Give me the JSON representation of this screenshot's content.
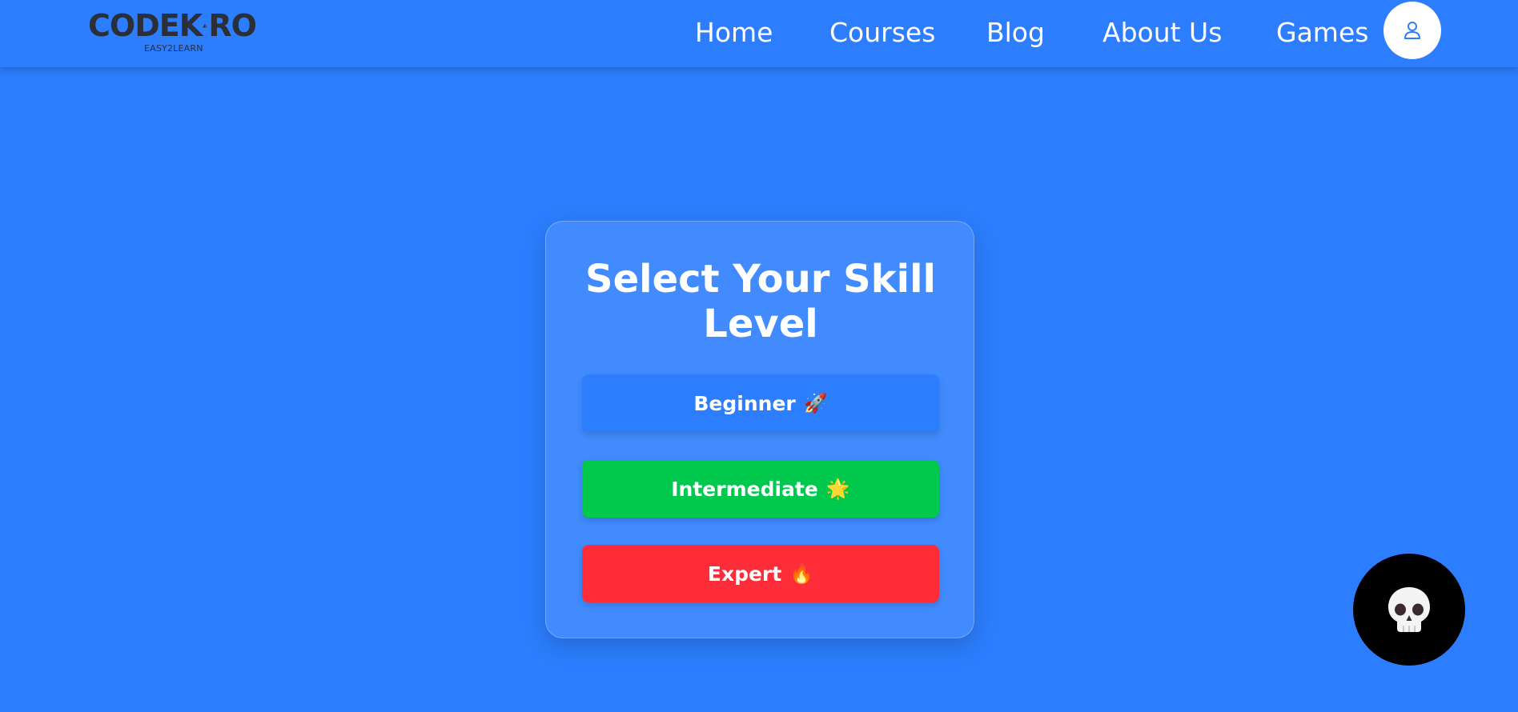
{
  "brand": {
    "logo_text_left": "CODEK",
    "logo_text_right": "RO",
    "tagline": "EASY2LEARN"
  },
  "nav": {
    "items": [
      {
        "label": "Home"
      },
      {
        "label": "Courses"
      },
      {
        "label": "Blog"
      },
      {
        "label": "About Us"
      },
      {
        "label": "Games"
      }
    ],
    "profile_icon": "user-icon"
  },
  "main": {
    "title_line1": "Select Your Skill",
    "title_line2": "Level",
    "levels": [
      {
        "label": "Beginner",
        "emoji": "🚀",
        "icon": "rocket-icon",
        "color": "#2c7efe"
      },
      {
        "label": "Intermediate",
        "emoji": "🌟",
        "icon": "star-icon",
        "color": "#00c94e"
      },
      {
        "label": "Expert",
        "emoji": "🔥",
        "icon": "fire-icon",
        "color": "#fe2b38"
      }
    ]
  },
  "floating_button": {
    "icon": "skull-icon"
  },
  "colors": {
    "background": "#2c7efe",
    "text": "#ffffff",
    "logo": "#2a2f3a"
  }
}
